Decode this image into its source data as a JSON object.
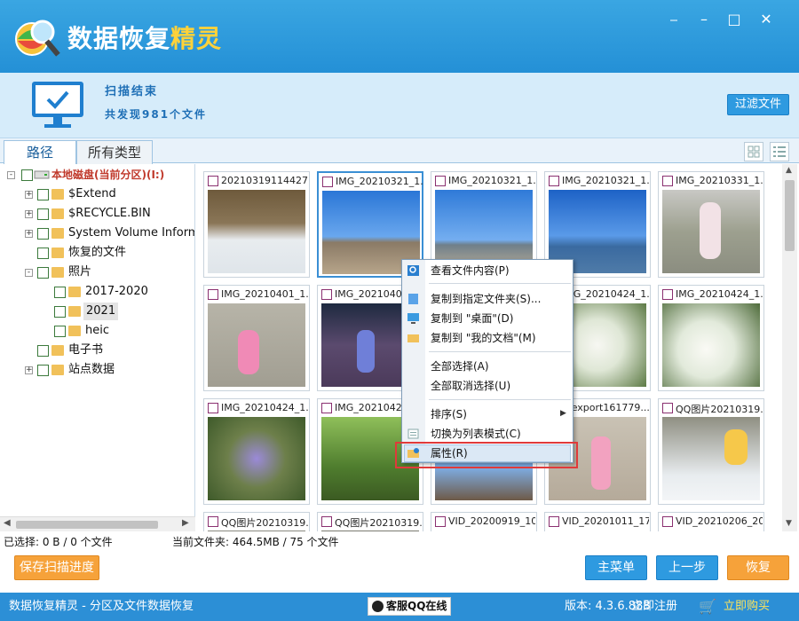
{
  "app": {
    "title_main": "数据恢复",
    "title_accent": "精灵"
  },
  "scan": {
    "title": "扫描结束",
    "count_text": "共发现981个文件",
    "filter_button": "过滤文件"
  },
  "tabs": [
    "路径",
    "所有类型"
  ],
  "tree": [
    {
      "label": "本地磁盘(当前分区)(I:)",
      "level": 0,
      "expander": "-"
    },
    {
      "label": "$Extend",
      "level": 1,
      "expander": "+"
    },
    {
      "label": "$RECYCLE.BIN",
      "level": 1,
      "expander": "+"
    },
    {
      "label": "System Volume Information",
      "level": 1,
      "expander": "+"
    },
    {
      "label": "恢复的文件",
      "level": 1,
      "expander": ""
    },
    {
      "label": "照片",
      "level": 1,
      "expander": "-"
    },
    {
      "label": "2017-2020",
      "level": 2,
      "expander": ""
    },
    {
      "label": "2021",
      "level": 2,
      "expander": ""
    },
    {
      "label": "heic",
      "level": 2,
      "expander": ""
    },
    {
      "label": "电子书",
      "level": 1,
      "expander": ""
    },
    {
      "label": "站点数据",
      "level": 1,
      "expander": "+"
    }
  ],
  "files": [
    "20210319114427.j...",
    "IMG_20210321_1...",
    "IMG_20210321_1...",
    "IMG_20210321_1...",
    "IMG_20210331_1...",
    "IMG_20210401_1...",
    "IMG_2021040",
    "IMG_20210424_1...",
    "IMG_20210424_1...",
    "IMG_20210424_1...",
    "IMG_20210424_1...",
    "IMG_2021042",
    "",
    "mexport161779...",
    "QQ图片20210319...",
    "QQ图片20210319...",
    "QQ图片20210319...",
    "VID_20200919_10...",
    "VID_20201011_17...",
    "VID_20210206_20..."
  ],
  "context_menu": {
    "view": "查看文件内容(P)",
    "copy_to_folder": "复制到指定文件夹(S)...",
    "copy_desktop": "复制到 \"桌面\"(D)",
    "copy_documents": "复制到 \"我的文档\"(M)",
    "select_all": "全部选择(A)",
    "deselect_all": "全部取消选择(U)",
    "sort": "排序(S)",
    "list_mode": "切换为列表模式(C)",
    "properties": "属性(R)"
  },
  "info": {
    "selected": "已选择: 0 B / 0 个文件",
    "current_folder": "当前文件夹: 464.5MB / 75 个文件"
  },
  "buttons": {
    "save_progress": "保存扫描进度",
    "main_menu": "主菜单",
    "prev_step": "上一步",
    "recover": "恢复"
  },
  "statusbar": {
    "left": "数据恢复精灵 - 分区及文件数据恢复",
    "qq": "客服QQ在线",
    "version": "版本: 4.3.6.888",
    "register": "立即注册",
    "buy": "立即购买"
  }
}
